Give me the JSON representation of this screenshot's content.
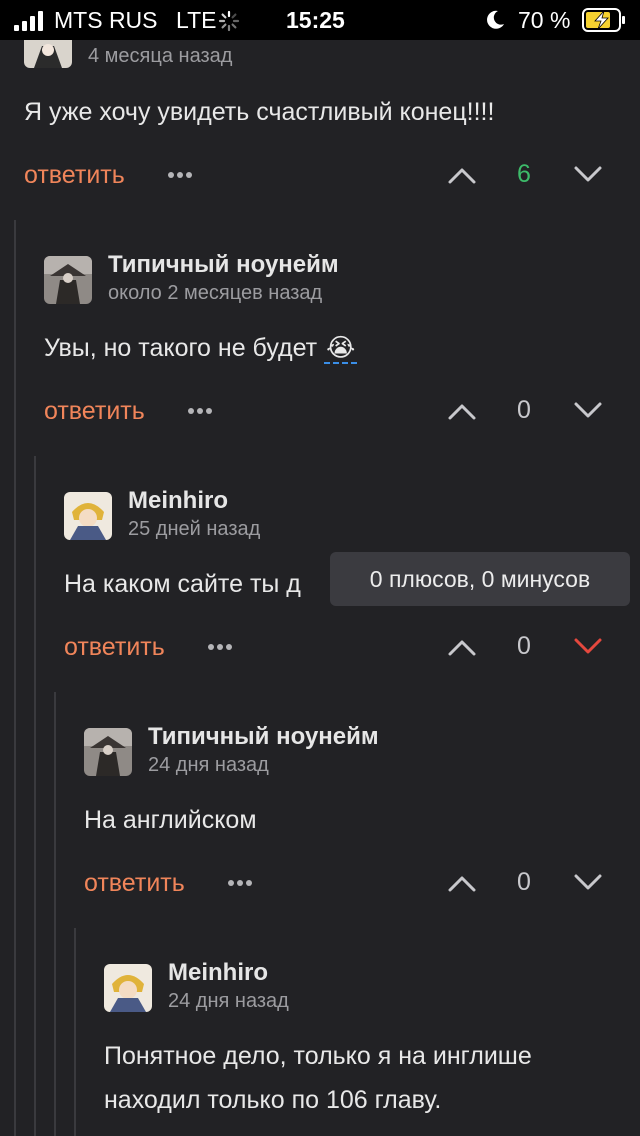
{
  "status_bar": {
    "carrier": "MTS RUS",
    "network": "LTE",
    "time": "15:25",
    "battery_percent": "70 %"
  },
  "comments": [
    {
      "author": "",
      "timestamp": "4 месяца назад",
      "text": "Я уже хочу увидеть счастливый конец!!!!",
      "reply_label": "ответить",
      "score": "6"
    },
    {
      "author": "Типичный ноунейм",
      "timestamp": "около 2 месяцев назад",
      "text": "Увы, но такого не будет",
      "emoji": "😭",
      "reply_label": "ответить",
      "score": "0"
    },
    {
      "author": "Meinhiro",
      "timestamp": "25 дней назад",
      "text": "На каком сайте ты д",
      "reply_label": "ответить",
      "score": "0",
      "downvote_active": true
    },
    {
      "author": "Типичный ноунейм",
      "timestamp": "24 дня назад",
      "text": "На английском",
      "reply_label": "ответить",
      "score": "0"
    },
    {
      "author": "Meinhiro",
      "timestamp": "24 дня назад",
      "text_lines": [
        "Понятное дело, только я на инглише",
        "находил только по 106 главу."
      ]
    }
  ],
  "tooltip": {
    "text": "0 плюсов, 0 минусов"
  },
  "colors": {
    "background": "#222225",
    "accent_reply": "#f0855a",
    "score_positive": "#3dbb6a",
    "downvote_active": "#e5483e",
    "thread_line": "#3a3a3e"
  },
  "icons": {
    "upvote": "chevron-up-icon",
    "downvote": "chevron-down-icon",
    "more": "more-dots-icon"
  }
}
